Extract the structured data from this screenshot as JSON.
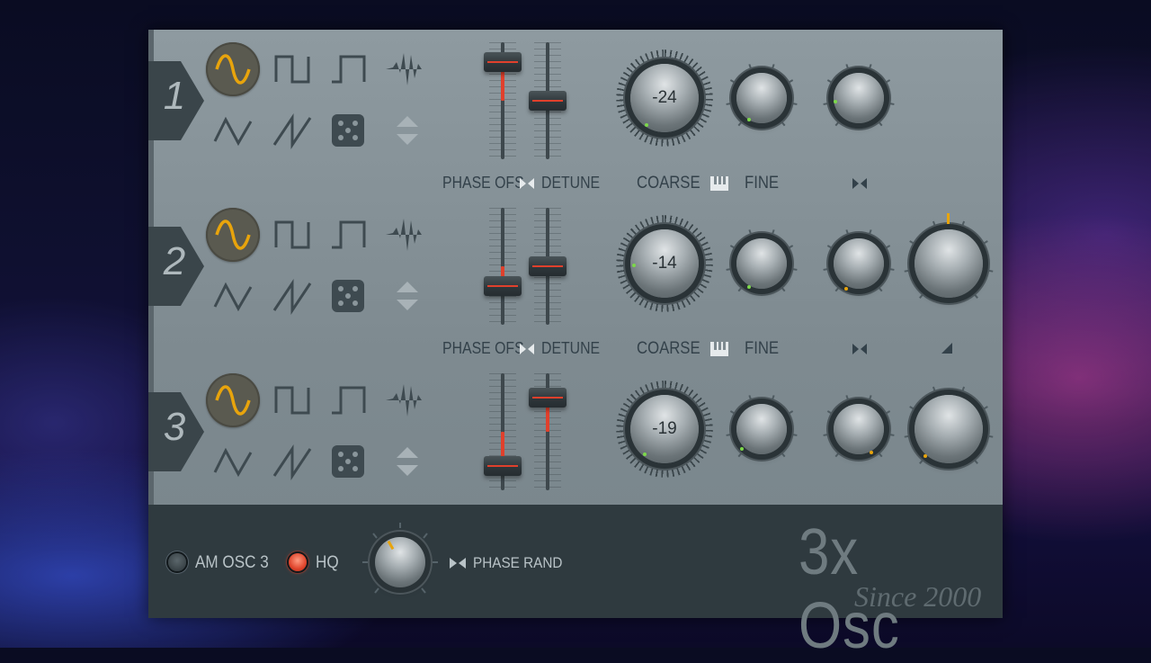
{
  "app": {
    "title": "3x Osc",
    "subtitle": "Since 2000"
  },
  "colors": {
    "accent": "#e8a40c",
    "fader_red": "#e0402c",
    "panel": "#849096",
    "bar": "#2f3a3f",
    "led_on": "#e0452c",
    "dot_green": "#7cd84a"
  },
  "oscillators": [
    {
      "number": "1",
      "selected_wave": "sine",
      "coarse": "-24",
      "phase_ofs_label": "PHASE OFS",
      "detune_label": "DETUNE",
      "coarse_label": "COARSE",
      "fine_label": "FINE",
      "phase_ofs_level": 0.9,
      "detune_level": 0.5
    },
    {
      "number": "2",
      "selected_wave": "sine",
      "coarse": "-14",
      "phase_ofs_label": "PHASE OFS",
      "detune_label": "DETUNE",
      "coarse_label": "COARSE",
      "fine_label": "FINE",
      "phase_ofs_level": 0.3,
      "detune_level": 0.5
    },
    {
      "number": "3",
      "selected_wave": "sine",
      "coarse": "-19",
      "phase_ofs_label": "PHASE OFS",
      "detune_label": "DETUNE",
      "coarse_label": "COARSE",
      "fine_label": "FINE",
      "phase_ofs_level": 0.15,
      "detune_level": 0.85
    }
  ],
  "waveforms": [
    "sine",
    "square",
    "pulse",
    "noise-shape",
    "triangle",
    "saw",
    "random-dice",
    "custom-updown"
  ],
  "bottom": {
    "am_label": "AM OSC 3",
    "am_on": false,
    "hq_label": "HQ",
    "hq_on": true,
    "phase_rand_label": "PHASE RAND"
  }
}
